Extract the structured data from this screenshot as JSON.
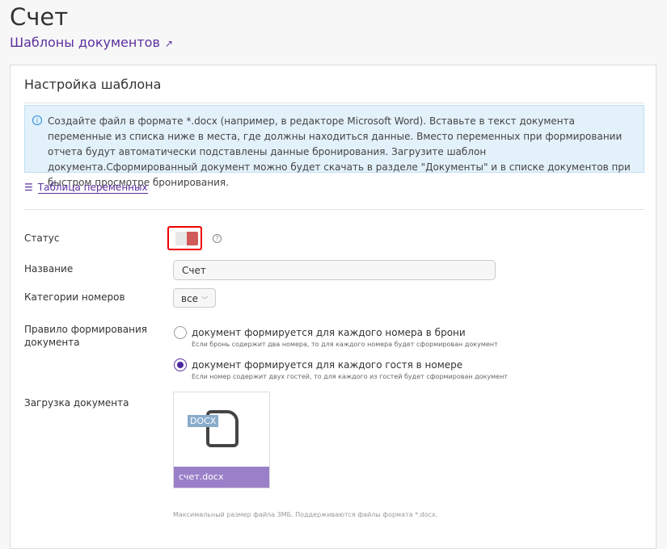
{
  "header": {
    "title": "Счет",
    "link": "Шаблоны документов"
  },
  "card": {
    "title": "Настройка шаблона",
    "info": "Создайте файл в формате *.docx (например, в редакторе Microsoft Word). Вставьте в текст документа переменные из списка ниже в места, где должны находиться данные. Вместо переменных при формировании отчета будут автоматически подставлены данные бронирования. Загрузите шаблон документа.Сформированный документ можно будет скачать в разделе \"Документы\" и в списке документов при быстром просмотре бронирования.",
    "vars_link": "Таблица переменных"
  },
  "form": {
    "status_label": "Статус",
    "status_on": true,
    "name_label": "Название",
    "name_value": "Счет",
    "categories_label": "Категории номеров",
    "categories_value": "все",
    "rule_label": "Правило формирования документа",
    "rules": [
      {
        "text": "документ формируется для каждого номера в брони",
        "hint": "Если бронь содержит два номера, то для каждого номера будет сформирован документ",
        "selected": false
      },
      {
        "text": "документ формируется для каждого гостя в номере",
        "hint": "Если номер содержит двух гостей, то для каждого из гостей будет сформирован документ",
        "selected": true
      }
    ],
    "upload_label": "Загрузка документа",
    "file_type": "DOCX",
    "file_name": "счет.docx",
    "note": "Максимальный размер файла 3МБ. Поддерживаются файлы формата *.docx."
  }
}
